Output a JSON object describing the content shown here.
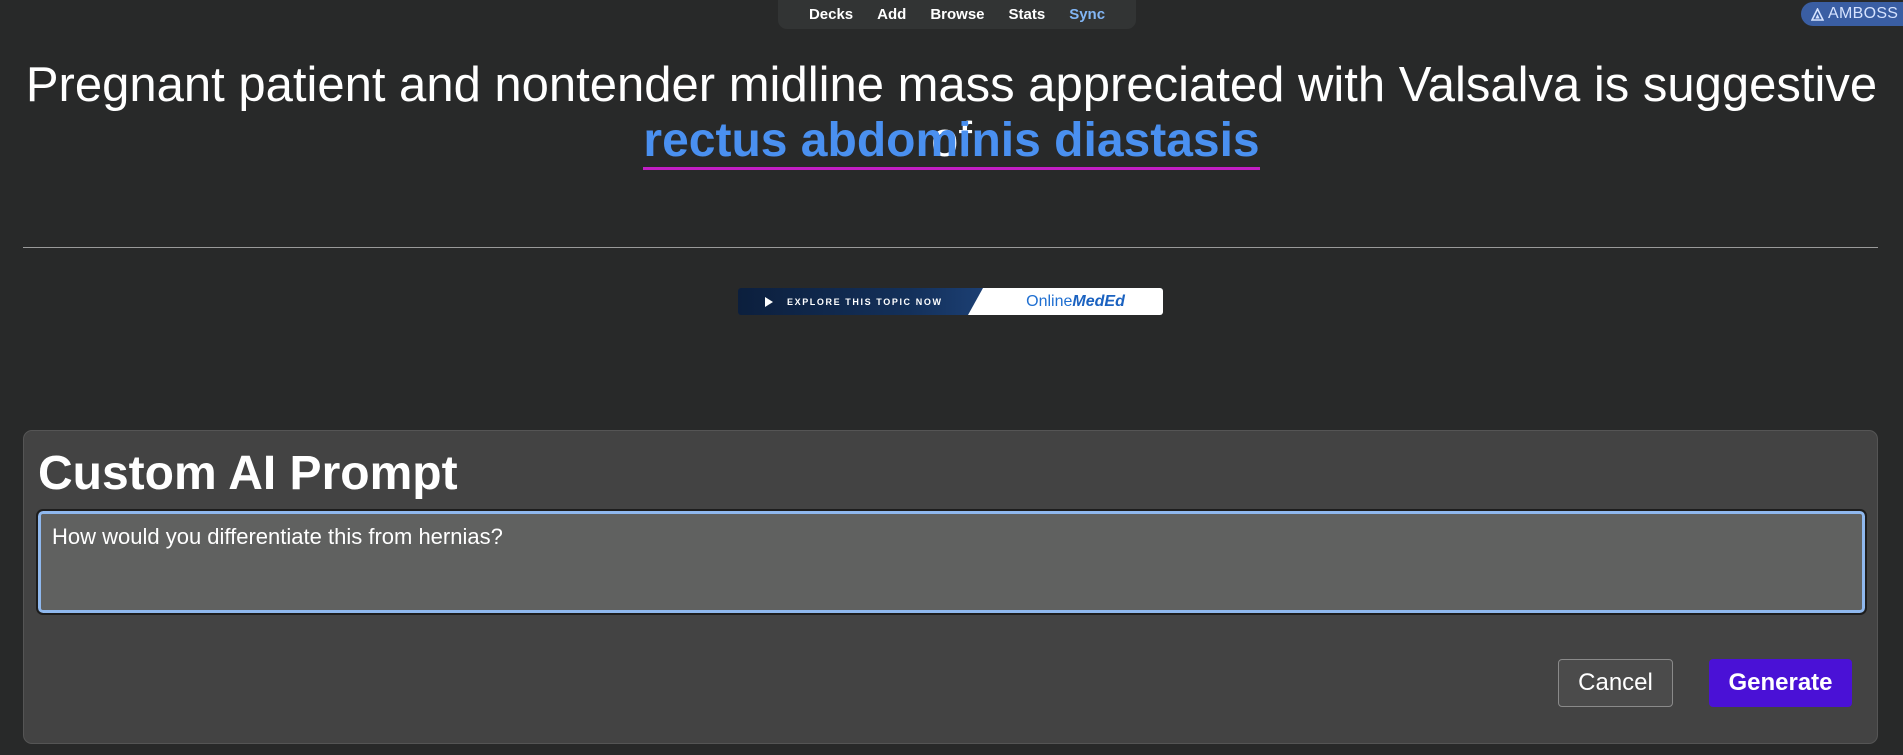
{
  "nav": {
    "items": [
      {
        "label": "Decks"
      },
      {
        "label": "Add"
      },
      {
        "label": "Browse"
      },
      {
        "label": "Stats"
      },
      {
        "label": "Sync"
      }
    ]
  },
  "amboss": {
    "label": "AMBOSS",
    "icon": "amboss-triangle-icon"
  },
  "card": {
    "question": "Pregnant patient and nontender midline mass appreciated with Valsalva is suggestive of",
    "answer": "rectus abdominis diastasis"
  },
  "banner": {
    "cta": "EXPLORE THIS TOPIC NOW",
    "brand_prefix": "Online",
    "brand_suffix": "MedEd",
    "icon": "play-icon"
  },
  "prompt_panel": {
    "title": "Custom AI Prompt",
    "input_value": "How would you differentiate this from hernias?",
    "cancel_label": "Cancel",
    "generate_label": "Generate"
  },
  "colors": {
    "background": "#282929",
    "answer_text": "#4a90f0",
    "answer_underline": "#c21ec4",
    "sync_link": "#82b6f5",
    "generate_button": "#4a11d6",
    "panel_bg": "#434343"
  }
}
